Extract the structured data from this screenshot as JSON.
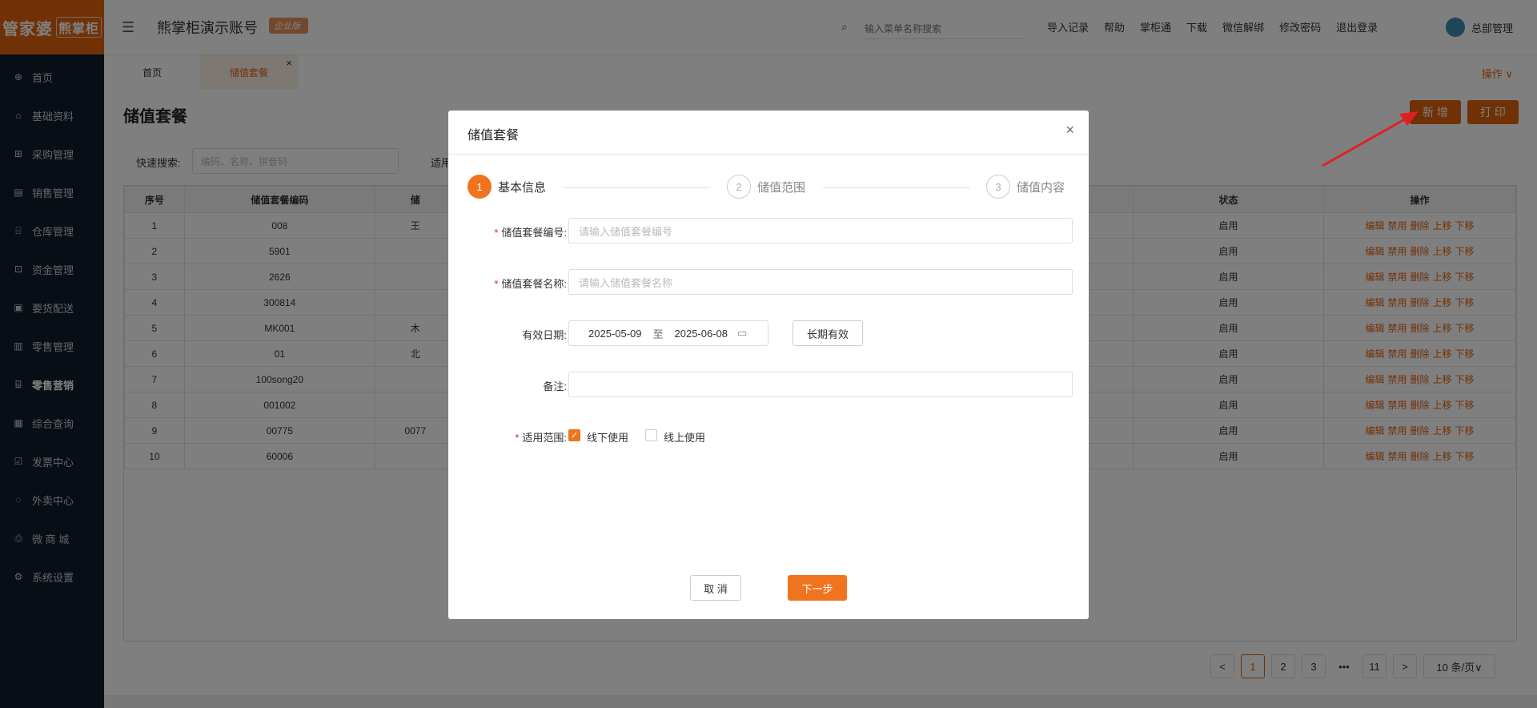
{
  "logo": {
    "main": "管家婆",
    "sub": "熊掌柜"
  },
  "sidebar": {
    "items": [
      {
        "label": "首页",
        "icon": "globe-icon",
        "glyph": "⊕"
      },
      {
        "label": "基础资料",
        "icon": "home-icon",
        "glyph": "⌂"
      },
      {
        "label": "采购管理",
        "icon": "cart-icon",
        "glyph": "⊞"
      },
      {
        "label": "销售管理",
        "icon": "sales-icon",
        "glyph": "▤"
      },
      {
        "label": "仓库管理",
        "icon": "warehouse-icon",
        "glyph": "⌸"
      },
      {
        "label": "资金管理",
        "icon": "money-icon",
        "glyph": "⊡"
      },
      {
        "label": "要货配送",
        "icon": "delivery-icon",
        "glyph": "▣"
      },
      {
        "label": "零售管理",
        "icon": "retail-icon",
        "glyph": "▥"
      },
      {
        "label": "零售营销",
        "icon": "gift-icon",
        "glyph": "⌹",
        "active": true
      },
      {
        "label": "综合查询",
        "icon": "chart-icon",
        "glyph": "▦"
      },
      {
        "label": "发票中心",
        "icon": "invoice-icon",
        "glyph": "☑"
      },
      {
        "label": "外卖中心",
        "icon": "takeout-icon",
        "glyph": "◌"
      },
      {
        "label": "微 商 城",
        "icon": "shop-icon",
        "glyph": "⎙"
      },
      {
        "label": "系统设置",
        "icon": "gear-icon",
        "glyph": "⚙"
      }
    ]
  },
  "header": {
    "menu_icon": "☰",
    "account": "熊掌柜演示账号",
    "edition": "企业版",
    "search_placeholder": "输入菜单名称搜索",
    "links": [
      "导入记录",
      "帮助",
      "掌柜通",
      "下载",
      "微信解绑",
      "修改密码",
      "退出登录"
    ],
    "user": "总部管理"
  },
  "tabs": {
    "home": "首页",
    "current": "储值套餐",
    "close": "×",
    "ops": "操作 ∨"
  },
  "page": {
    "title": "储值套餐",
    "add_button": "新 增",
    "print_button": "打 印",
    "quick_search_label": "快速搜索:",
    "quick_search_placeholder": "编码、名称、拼音码",
    "scope_label": "适用"
  },
  "table": {
    "headers": {
      "no": "序号",
      "code": "储值套餐编码",
      "name": "储",
      "status": "状态",
      "ops": "操作"
    },
    "actions": [
      "编辑",
      "禁用",
      "删除",
      "上移",
      "下移"
    ],
    "rows": [
      {
        "no": "1",
        "code": "008",
        "name": "王",
        "status": "启用"
      },
      {
        "no": "2",
        "code": "5901",
        "name": "",
        "status": "启用"
      },
      {
        "no": "3",
        "code": "2626",
        "name": "",
        "status": "启用"
      },
      {
        "no": "4",
        "code": "300814",
        "name": "",
        "status": "启用"
      },
      {
        "no": "5",
        "code": "MK001",
        "name": "木",
        "status": "启用"
      },
      {
        "no": "6",
        "code": "01",
        "name": "北",
        "status": "启用"
      },
      {
        "no": "7",
        "code": "100song20",
        "name": "",
        "status": "启用"
      },
      {
        "no": "8",
        "code": "001002",
        "name": "",
        "status": "启用"
      },
      {
        "no": "9",
        "code": "00775",
        "name": "0077",
        "status": "启用"
      },
      {
        "no": "10",
        "code": "60006",
        "name": "",
        "status": "启用"
      }
    ]
  },
  "pagination": {
    "prev": "<",
    "pages": [
      "1",
      "2",
      "3"
    ],
    "dots": "•••",
    "last": "11",
    "next": ">",
    "size": "10 条/页∨"
  },
  "modal": {
    "title": "储值套餐",
    "close": "×",
    "steps": [
      {
        "num": "1",
        "label": "基本信息"
      },
      {
        "num": "2",
        "label": "储值范围"
      },
      {
        "num": "3",
        "label": "储值内容"
      }
    ],
    "code_label": "储值套餐编号:",
    "code_placeholder": "请输入储值套餐编号",
    "name_label": "储值套餐名称:",
    "name_placeholder": "请输入储值套餐名称",
    "date_label": "有效日期:",
    "date_start": "2025-05-09",
    "date_to": "至",
    "date_end": "2025-06-08",
    "long_valid": "长期有效",
    "remark_label": "备注:",
    "scope_label": "适用范围:",
    "offline": "线下使用",
    "offline_checked": true,
    "online": "线上使用",
    "online_checked": false,
    "cancel": "取 消",
    "next": "下一步"
  }
}
